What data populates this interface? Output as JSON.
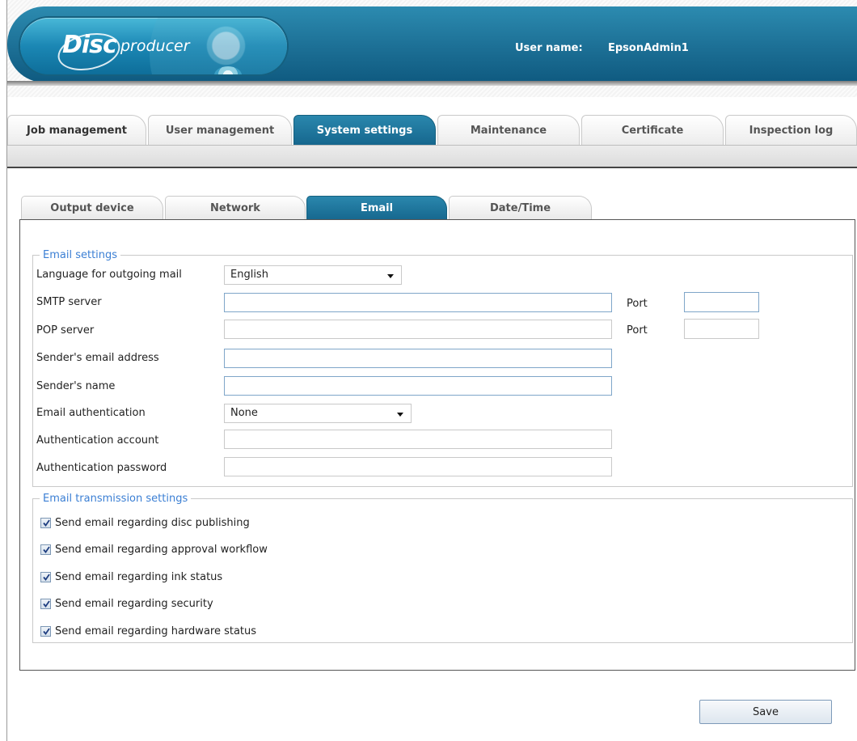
{
  "header": {
    "logo_disc": "Disc",
    "logo_producer": "producer",
    "user_label": "User name:",
    "user_name": "EpsonAdmin1"
  },
  "main_tabs": [
    {
      "label": "Job management",
      "active": false
    },
    {
      "label": "User management",
      "active": false
    },
    {
      "label": "System settings",
      "active": true
    },
    {
      "label": "Maintenance",
      "active": false
    },
    {
      "label": "Certificate",
      "active": false
    },
    {
      "label": "Inspection log",
      "active": false
    }
  ],
  "sub_tabs": [
    {
      "label": "Output device",
      "active": false
    },
    {
      "label": "Network",
      "active": false
    },
    {
      "label": "Email",
      "active": true
    },
    {
      "label": "Date/Time",
      "active": false
    }
  ],
  "email_settings": {
    "legend": "Email settings",
    "language_label": "Language for outgoing mail",
    "language_value": "English",
    "smtp_label": "SMTP server",
    "smtp_value": "",
    "smtp_port_label": "Port",
    "smtp_port_value": "",
    "pop_label": "POP server",
    "pop_value": "",
    "pop_port_label": "Port",
    "pop_port_value": "",
    "sender_email_label": "Sender's email address",
    "sender_email_value": "",
    "sender_name_label": "Sender's name",
    "sender_name_value": "",
    "auth_label": "Email authentication",
    "auth_value": "None",
    "auth_account_label": "Authentication account",
    "auth_account_value": "",
    "auth_password_label": "Authentication password",
    "auth_password_value": ""
  },
  "transmission_settings": {
    "legend": "Email transmission settings",
    "items": [
      {
        "label": "Send email regarding disc publishing",
        "checked": true
      },
      {
        "label": "Send email regarding approval workflow",
        "checked": true
      },
      {
        "label": "Send email regarding ink status",
        "checked": true
      },
      {
        "label": "Send email regarding security",
        "checked": true
      },
      {
        "label": "Send email regarding hardware status",
        "checked": true
      }
    ]
  },
  "actions": {
    "save_label": "Save"
  },
  "colors": {
    "accent": "#1b6f95",
    "legend": "#3b7fd4"
  }
}
